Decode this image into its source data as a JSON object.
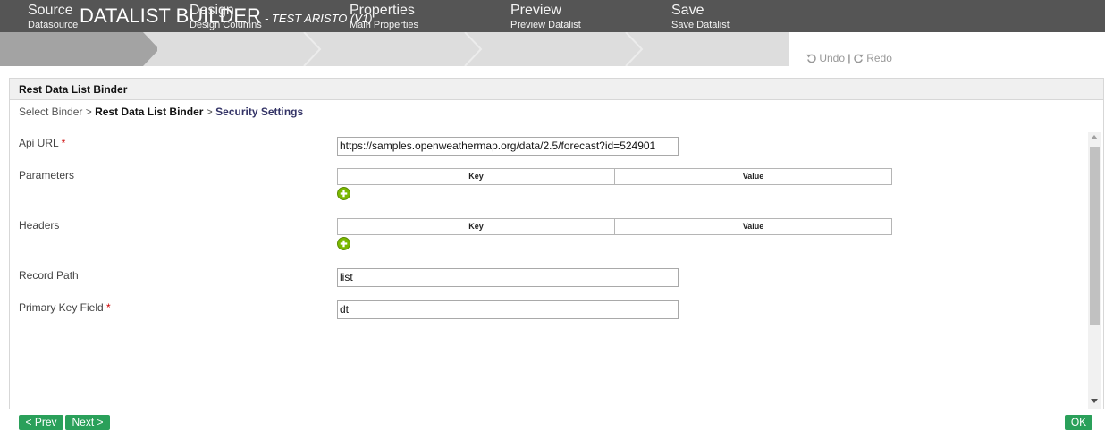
{
  "header": {
    "title": "DATALIST BUILDER",
    "subtitle": "- TEST ARISTO (V1)"
  },
  "steps": [
    {
      "title": "Source",
      "subtitle": "Datasource",
      "active": true
    },
    {
      "title": "Design",
      "subtitle": "Design Columns",
      "active": false
    },
    {
      "title": "Properties",
      "subtitle": "Main Properties",
      "active": false
    },
    {
      "title": "Preview",
      "subtitle": "Preview Datalist",
      "active": false
    },
    {
      "title": "Save",
      "subtitle": "Save Datalist",
      "active": false
    }
  ],
  "history": {
    "undo": "Undo",
    "separator": "|",
    "redo": "Redo"
  },
  "panel": {
    "title": "Rest Data List Binder"
  },
  "breadcrumb": {
    "root": "Select Binder",
    "sep1": ">",
    "current": "Rest Data List Binder",
    "sep2": ">",
    "next": "Security Settings"
  },
  "form": {
    "api_url": {
      "label": "Api URL",
      "required": "*",
      "value": "https://samples.openweathermap.org/data/2.5/forecast?id=524901"
    },
    "parameters": {
      "label": "Parameters",
      "key_header": "Key",
      "value_header": "Value"
    },
    "headers": {
      "label": "Headers",
      "key_header": "Key",
      "value_header": "Value"
    },
    "record_path": {
      "label": "Record Path",
      "value": "list"
    },
    "primary_key": {
      "label": "Primary Key Field",
      "required": "*",
      "value": "dt"
    }
  },
  "footer": {
    "prev": "< Prev",
    "next": "Next >",
    "ok": "OK"
  },
  "colors": {
    "header_bg": "#555555",
    "step_active": "#a3a3a3",
    "step_inactive": "#dddddd",
    "button_green": "#2aa05a",
    "add_icon": "#7ab800"
  }
}
